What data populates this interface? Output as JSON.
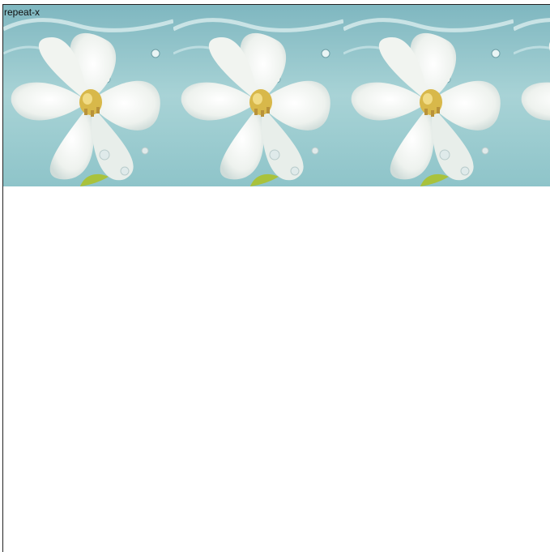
{
  "demo": {
    "label": "repeat-x",
    "background_repeat": "repeat-x",
    "tile_subject": "white-flower-on-water",
    "colors": {
      "water": "#9fcfd3",
      "petal": "#f4f6f2",
      "stamen": "#d8b84a",
      "leaf": "#a9c23c"
    }
  }
}
